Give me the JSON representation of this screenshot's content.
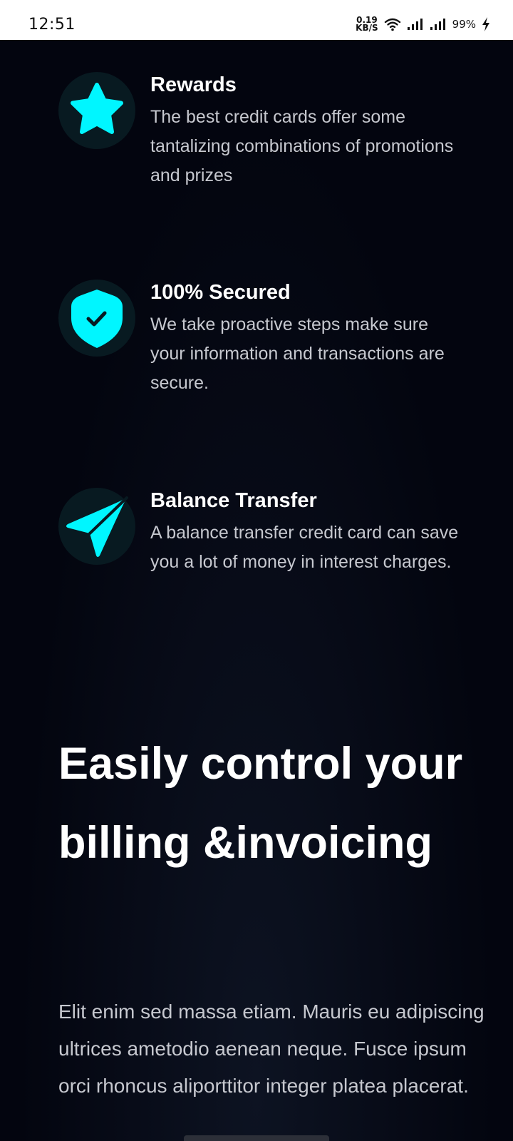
{
  "status_bar": {
    "time": "12:51",
    "net_speed_value": "0.19",
    "net_speed_unit": "KB/S",
    "battery": "99%",
    "icons": [
      "wifi-icon",
      "signal-icon",
      "signal-icon",
      "charging-icon"
    ]
  },
  "features": [
    {
      "icon": "star-icon",
      "title": "Rewards",
      "description": "The best credit cards offer some tantalizing combinations of promotions and prizes"
    },
    {
      "icon": "shield-check-icon",
      "title": "100% Secured",
      "description": "We take proactive steps make sure your information and transactions are secure."
    },
    {
      "icon": "paper-plane-icon",
      "title": "Balance Transfer",
      "description": "A balance transfer credit card can save you a lot of money in interest charges."
    }
  ],
  "billing": {
    "heading": "Easily control your billing &invoicing",
    "body": "Elit enim sed massa etiam. Mauris eu adipiscing ultrices ametodio aenean neque. Fusce ipsum orci rhoncus aliporttitor integer platea placerat."
  },
  "colors": {
    "background": "#03050f",
    "accent": "#00f6ff",
    "icon_circle": "#081a21",
    "heading": "#ffffff",
    "body_text": "#c6c8cf"
  }
}
